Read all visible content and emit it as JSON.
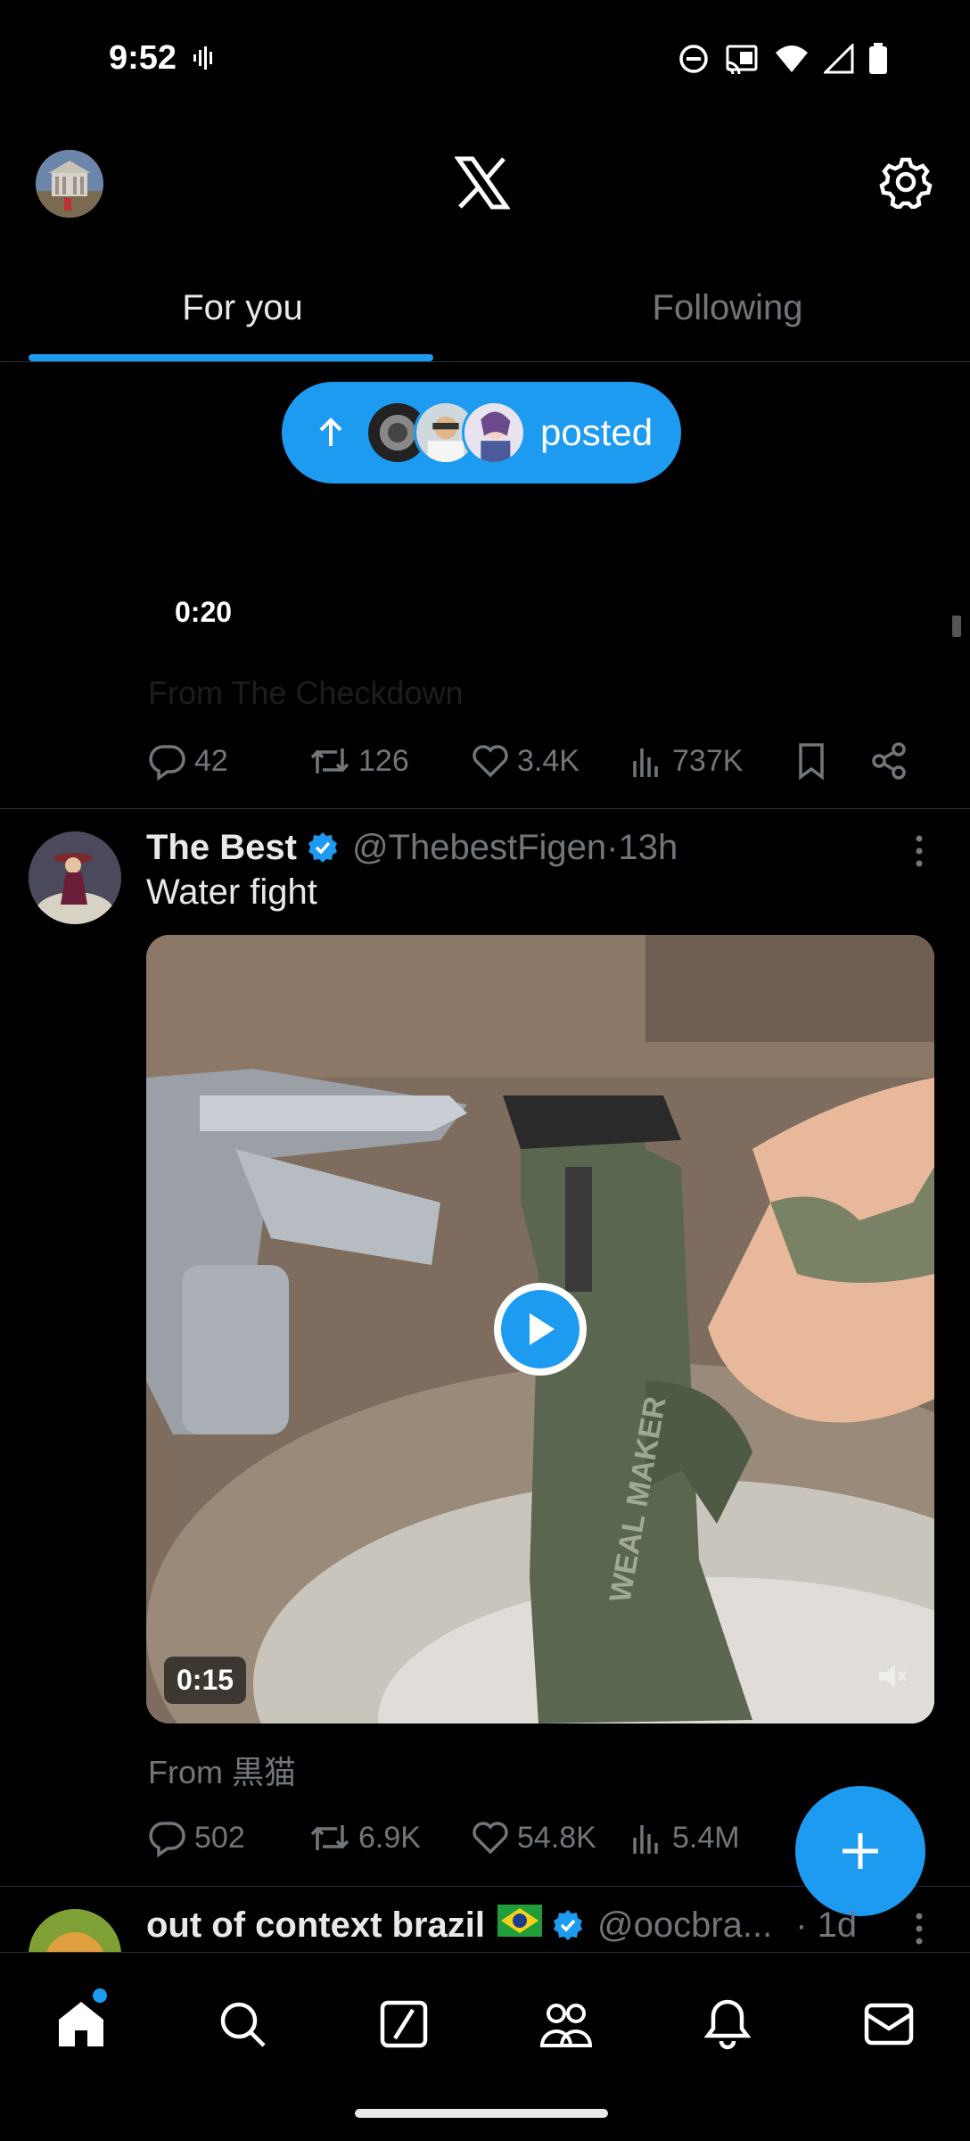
{
  "status_bar": {
    "time": "9:52"
  },
  "header": {
    "logo": "x-logo-icon",
    "settings_icon": "gear-icon"
  },
  "tabs": [
    {
      "label": "For you",
      "active": true
    },
    {
      "label": "Following",
      "active": false
    }
  ],
  "new_posts_pill": {
    "label": "posted",
    "icon": "arrow-up-icon"
  },
  "previous_tweet": {
    "video_time": "0:20",
    "from": "From The Checkdown",
    "stats": {
      "replies": "42",
      "reposts": "126",
      "likes": "3.4K",
      "views": "737K"
    }
  },
  "tweet": {
    "name": "The Best",
    "handle": "@ThebestFigen",
    "separator": " · ",
    "time": "13h",
    "text": "Water fight",
    "video_time": "0:15",
    "from": "From 黒猫",
    "stats": {
      "replies": "502",
      "reposts": "6.9K",
      "likes": "54.8K",
      "views": "5.4M"
    }
  },
  "next_tweet": {
    "name": "out of context brazil",
    "flag": "🇧🇷",
    "handle": "@oocbra...",
    "time": "· 1d"
  },
  "fab": {
    "icon": "plus-icon"
  },
  "bottom_nav": [
    "home-icon",
    "search-icon",
    "grok-icon",
    "communities-icon",
    "notifications-icon",
    "messages-icon"
  ],
  "colors": {
    "accent": "#1d9bf0",
    "background": "#000000",
    "muted": "#71767b",
    "text": "#e7e9ea"
  }
}
